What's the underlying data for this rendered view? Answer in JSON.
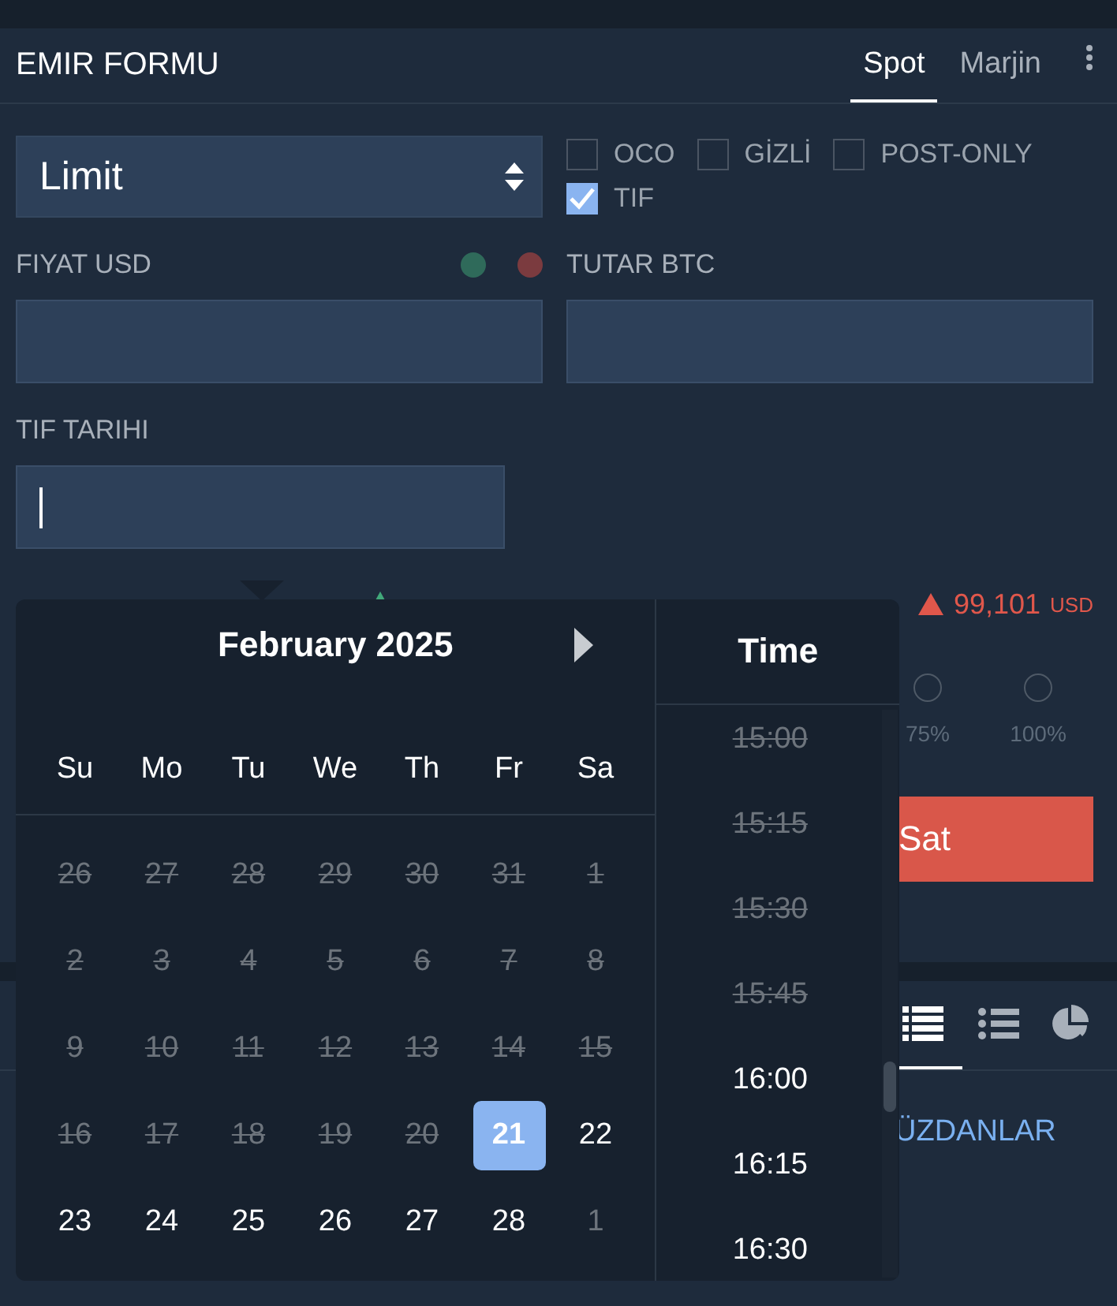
{
  "header": {
    "title": "EMIR FORMU",
    "tabs": [
      {
        "label": "Spot",
        "selected": true
      },
      {
        "label": "Marjin",
        "selected": false
      }
    ]
  },
  "order_type": {
    "value": "Limit"
  },
  "options": [
    {
      "label": "OCO",
      "checked": false
    },
    {
      "label": "GİZLİ",
      "checked": false
    },
    {
      "label": "POST-ONLY",
      "checked": false
    },
    {
      "label": "TIF",
      "checked": true
    }
  ],
  "price": {
    "label": "FIYAT USD",
    "indicators": [
      {
        "color": "#2f6a5a"
      },
      {
        "color": "#7b3b3f"
      }
    ]
  },
  "amount": {
    "label": "TUTAR BTC"
  },
  "tif_date": {
    "label": "TIF TARIHI"
  },
  "sell": {
    "price": "99,101",
    "currency": "USD",
    "percent_labels": [
      "75%",
      "100%"
    ],
    "button": "Sat"
  },
  "lower_panel": {
    "tabs": [
      {
        "kind": "table",
        "selected": true
      },
      {
        "kind": "list",
        "selected": false
      },
      {
        "kind": "pie",
        "selected": false
      }
    ],
    "link": "ÜZDANLAR"
  },
  "date_picker": {
    "month": "February 2025",
    "weekdays": [
      "Su",
      "Mo",
      "Tu",
      "We",
      "Th",
      "Fr",
      "Sa"
    ],
    "days": [
      {
        "label": "26",
        "disabled": true,
        "selected": false,
        "outside_month": true
      },
      {
        "label": "27",
        "disabled": true,
        "selected": false,
        "outside_month": true
      },
      {
        "label": "28",
        "disabled": true,
        "selected": false,
        "outside_month": true
      },
      {
        "label": "29",
        "disabled": true,
        "selected": false,
        "outside_month": true
      },
      {
        "label": "30",
        "disabled": true,
        "selected": false,
        "outside_month": true
      },
      {
        "label": "31",
        "disabled": true,
        "selected": false,
        "outside_month": true
      },
      {
        "label": "1",
        "disabled": true,
        "selected": false,
        "outside_month": false
      },
      {
        "label": "2",
        "disabled": true,
        "selected": false,
        "outside_month": false
      },
      {
        "label": "3",
        "disabled": true,
        "selected": false,
        "outside_month": false
      },
      {
        "label": "4",
        "disabled": true,
        "selected": false,
        "outside_month": false
      },
      {
        "label": "5",
        "disabled": true,
        "selected": false,
        "outside_month": false
      },
      {
        "label": "6",
        "disabled": true,
        "selected": false,
        "outside_month": false
      },
      {
        "label": "7",
        "disabled": true,
        "selected": false,
        "outside_month": false
      },
      {
        "label": "8",
        "disabled": true,
        "selected": false,
        "outside_month": false
      },
      {
        "label": "9",
        "disabled": true,
        "selected": false,
        "outside_month": false
      },
      {
        "label": "10",
        "disabled": true,
        "selected": false,
        "outside_month": false
      },
      {
        "label": "11",
        "disabled": true,
        "selected": false,
        "outside_month": false
      },
      {
        "label": "12",
        "disabled": true,
        "selected": false,
        "outside_month": false
      },
      {
        "label": "13",
        "disabled": true,
        "selected": false,
        "outside_month": false
      },
      {
        "label": "14",
        "disabled": true,
        "selected": false,
        "outside_month": false
      },
      {
        "label": "15",
        "disabled": true,
        "selected": false,
        "outside_month": false
      },
      {
        "label": "16",
        "disabled": true,
        "selected": false,
        "outside_month": false
      },
      {
        "label": "17",
        "disabled": true,
        "selected": false,
        "outside_month": false
      },
      {
        "label": "18",
        "disabled": true,
        "selected": false,
        "outside_month": false
      },
      {
        "label": "19",
        "disabled": true,
        "selected": false,
        "outside_month": false
      },
      {
        "label": "20",
        "disabled": true,
        "selected": false,
        "outside_month": false
      },
      {
        "label": "21",
        "disabled": false,
        "selected": true,
        "outside_month": false
      },
      {
        "label": "22",
        "disabled": false,
        "selected": false,
        "outside_month": false
      },
      {
        "label": "23",
        "disabled": false,
        "selected": false,
        "outside_month": false
      },
      {
        "label": "24",
        "disabled": false,
        "selected": false,
        "outside_month": false
      },
      {
        "label": "25",
        "disabled": false,
        "selected": false,
        "outside_month": false
      },
      {
        "label": "26",
        "disabled": false,
        "selected": false,
        "outside_month": false
      },
      {
        "label": "27",
        "disabled": false,
        "selected": false,
        "outside_month": false
      },
      {
        "label": "28",
        "disabled": false,
        "selected": false,
        "outside_month": false
      },
      {
        "label": "1",
        "disabled": false,
        "selected": false,
        "outside_month": true
      }
    ],
    "time_title": "Time",
    "times": [
      {
        "label": "15:00",
        "disabled": true
      },
      {
        "label": "15:15",
        "disabled": true
      },
      {
        "label": "15:30",
        "disabled": true
      },
      {
        "label": "15:45",
        "disabled": true
      },
      {
        "label": "16:00",
        "disabled": false
      },
      {
        "label": "16:15",
        "disabled": false
      },
      {
        "label": "16:30",
        "disabled": false
      }
    ]
  }
}
